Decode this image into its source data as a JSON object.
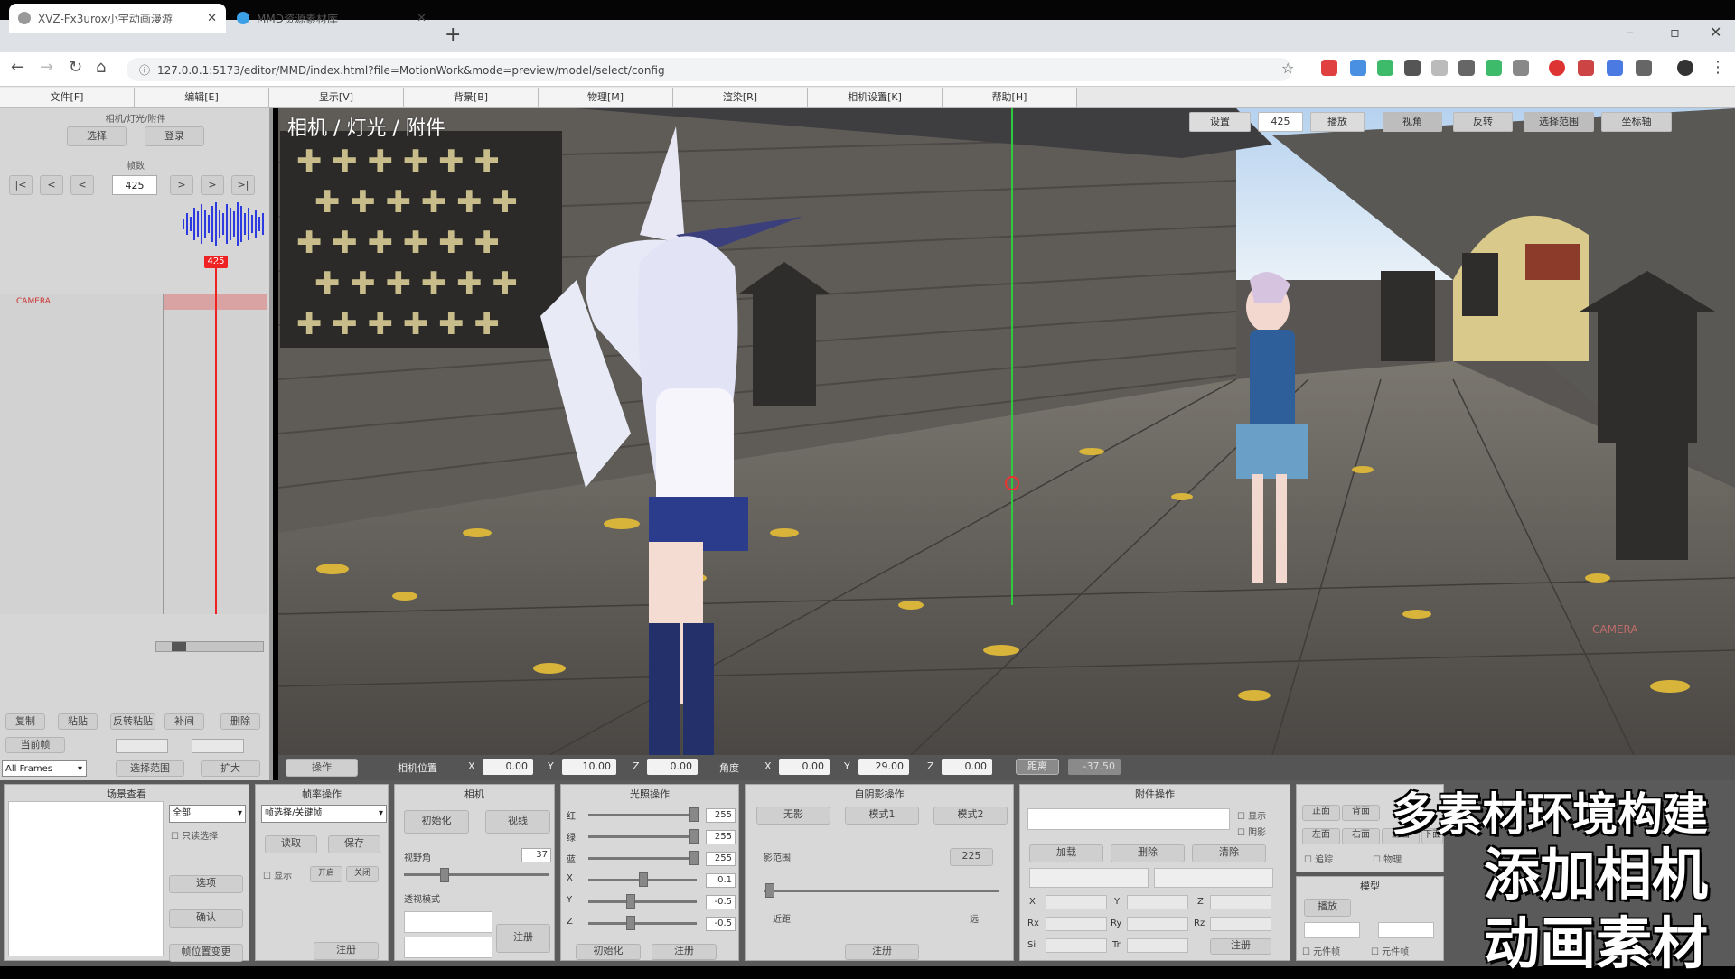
{
  "browser": {
    "tabs": [
      {
        "label": "XVZ-Fx3urox小宇动画漫游",
        "active": true
      },
      {
        "label": "MMD资源素材库",
        "active": false
      }
    ],
    "new_tab": "+",
    "url": "127.0.0.1:5173/editor/MMD/index.html?file=MotionWork&mode=preview/model/select/config",
    "window_controls": [
      "–",
      "▫",
      "✕"
    ]
  },
  "menu": [
    "文件[F]",
    "编辑[E]",
    "显示[V]",
    "背景[B]",
    "物理[M]",
    "渲染[R]",
    "相机设置[K]",
    "帮助[H]"
  ],
  "left": {
    "header_label": "相机/灯光/附件",
    "btn_select": "选择",
    "btn_register": "登录",
    "frame_label": "帧数",
    "frame_value": "425",
    "nav_buttons": [
      "|<",
      "<",
      "<",
      ">",
      ">",
      ">|"
    ],
    "playhead_value": "425",
    "track_label": "CAMERA",
    "bottom_buttons": [
      "复制",
      "粘贴",
      "反转粘贴",
      "补间",
      "删除"
    ],
    "row2_label": "当前帧",
    "frame_select": "All Frames",
    "row3_buttons": [
      "选择范围",
      "扩大"
    ]
  },
  "viewport": {
    "title": "相机 / 灯光 / 附件",
    "top_buttons": [
      "设置",
      "425",
      "播放",
      "视角",
      "反转",
      "选择范围",
      "坐标轴"
    ],
    "corner_label": "CAMERA"
  },
  "vstrip": {
    "button": "操作",
    "pos_label": "相机位置",
    "x": "0.00",
    "y": "10.00",
    "z": "0.00",
    "angle_label": "角度",
    "ax": "0.00",
    "ay": "29.00",
    "az": "0.00",
    "dist_btn": "距离",
    "dist_val": "-37.50"
  },
  "panels": {
    "p1_title": "场景查看",
    "p1_select": "全部",
    "p1_check": "只读选择",
    "p1_btns": [
      "选项",
      "确认",
      "帧位置变更"
    ],
    "p2_title": "帧率操作",
    "p2_select": "帧选择/关键帧",
    "p2_btns": [
      "读取",
      "保存"
    ],
    "p2_check": "显示",
    "p2_extra": [
      "开启",
      "关闭"
    ],
    "p2_bottom": "注册",
    "p3_title": "相机",
    "p3_btns": [
      "初始化",
      "视线"
    ],
    "p3_fov_label": "视野角",
    "p3_fov": "37",
    "p3_dist_label": "透视模式",
    "p3_reg": "注册",
    "p4_title": "光照操作",
    "p4_vals": [
      "255",
      "255",
      "255",
      "0.1",
      "-0.5",
      "-0.5"
    ],
    "p4_labels": [
      "红",
      "绿",
      "蓝",
      "X",
      "Y",
      "Z"
    ],
    "p4_btns": [
      "初始化",
      "注册"
    ],
    "p5_title": "自阴影操作",
    "p5_btns": [
      "无影",
      "模式1",
      "模式2"
    ],
    "p5_label": "影范围",
    "p5_val": "225",
    "p5_left": "近距",
    "p5_right": "远",
    "p5_reg": "注册",
    "p6_title": "附件操作",
    "p6_checks": [
      "显示",
      "阴影"
    ],
    "p6_btns": [
      "加载",
      "删除",
      "清除"
    ],
    "p6_labels": [
      "X",
      "Y",
      "Z",
      "Rx",
      "Ry",
      "Rz",
      "Si",
      "Tr"
    ],
    "p6_reg": "注册",
    "p7_btns": [
      "正面",
      "背面",
      "左面",
      "右面",
      "上面",
      "下面"
    ],
    "p7_checks": [
      "追踪",
      "物理"
    ],
    "p7_label": "模型",
    "p7_btn2": "播放",
    "p7_checks2": [
      "元件帧",
      "元件帧"
    ]
  },
  "captions": [
    "多素材环境构建",
    "添加相机",
    "动画素材"
  ]
}
